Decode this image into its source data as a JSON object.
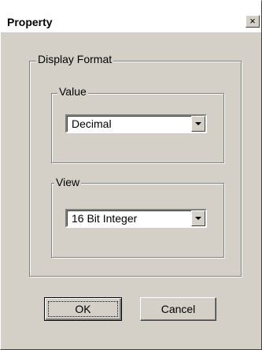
{
  "window": {
    "title": "Property",
    "close_glyph": "×"
  },
  "display_format": {
    "label": "Display Format",
    "value": {
      "label": "Value",
      "selected": "Decimal"
    },
    "view": {
      "label": "View",
      "selected": "16 Bit Integer"
    }
  },
  "buttons": {
    "ok": "OK",
    "cancel": "Cancel"
  },
  "icons": {
    "close": "close-icon",
    "dropdown": "chevron-down-icon"
  }
}
